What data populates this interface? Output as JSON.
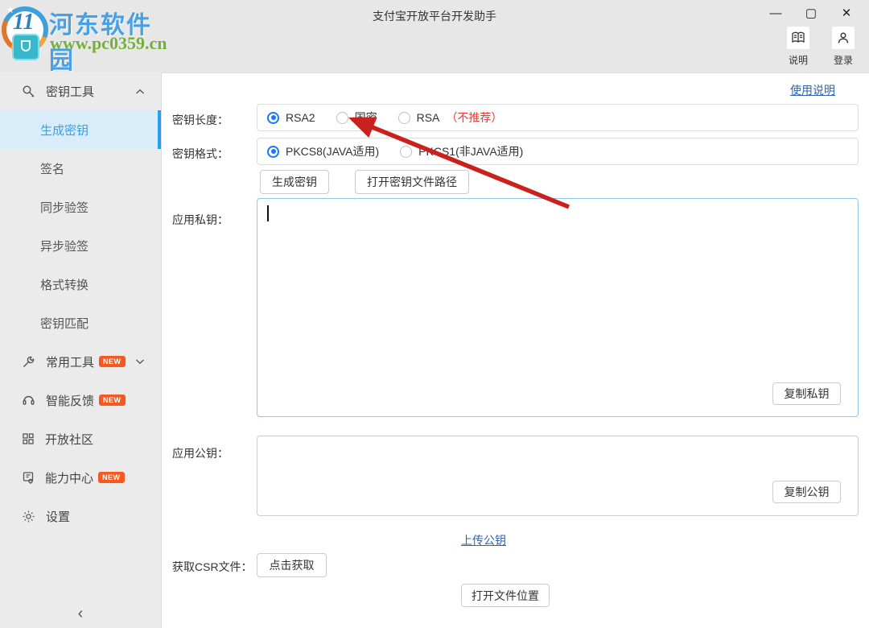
{
  "window": {
    "title": "支付宝开放平台开发助手",
    "minimize_glyph": "—",
    "maximize_glyph": "▢",
    "close_glyph": "✕"
  },
  "watermark": {
    "site_name": "河东软件园",
    "site_url": "www.pc0359.cn",
    "logo_number": "11",
    "logo_star": "★"
  },
  "topbar": {
    "help_label": "说明",
    "login_label": "登录"
  },
  "sidebar": {
    "key_tools_group": {
      "label": "密钥工具",
      "expanded": true
    },
    "sub_items": [
      {
        "label": "生成密钥",
        "active": true
      },
      {
        "label": "签名",
        "active": false
      },
      {
        "label": "同步验签",
        "active": false
      },
      {
        "label": "异步验签",
        "active": false
      },
      {
        "label": "格式转换",
        "active": false
      },
      {
        "label": "密钥匹配",
        "active": false
      }
    ],
    "items": [
      {
        "label": "常用工具",
        "badge": "NEW",
        "collapsed": true
      },
      {
        "label": "智能反馈",
        "badge": "NEW"
      },
      {
        "label": "开放社区",
        "badge": ""
      },
      {
        "label": "能力中心",
        "badge": "NEW"
      }
    ],
    "settings": {
      "label": "设置"
    },
    "collapse_glyph": "‹",
    "icons": [
      "key-icon",
      "wrench-icon",
      "headset-icon",
      "grid-icon",
      "capability-icon",
      "gear-icon",
      "chevron-up-icon",
      "chevron-down-icon"
    ]
  },
  "main": {
    "usage_link": "使用说明",
    "key_length": {
      "label": "密钥长度：",
      "options": [
        {
          "label": "RSA2",
          "selected": true
        },
        {
          "label": "国密",
          "selected": false
        },
        {
          "label": "RSA",
          "selected": false,
          "note": "（不推荐）"
        }
      ]
    },
    "key_format": {
      "label": "密钥格式：",
      "options": [
        {
          "label": "PKCS8(JAVA适用)",
          "selected": true
        },
        {
          "label": "PKCS1(非JAVA适用)",
          "selected": false
        }
      ]
    },
    "generate_button": "生成密钥",
    "open_key_path_button": "打开密钥文件路径",
    "private_key": {
      "label": "应用私钥：",
      "value": "",
      "copy_button": "复制私钥",
      "focused": true
    },
    "public_key": {
      "label": "应用公钥：",
      "value": "",
      "copy_button": "复制公钥"
    },
    "upload_link": "上传公钥",
    "csr": {
      "label": "获取CSR文件：",
      "button": "点击获取"
    },
    "open_file_location_button": "打开文件位置"
  },
  "annotation": {
    "arrow_color": "#c9221e",
    "arrow_points_to": "国密 radio option"
  },
  "colors": {
    "topbar_bg": "#e7e7e7",
    "sidebar_bg": "#ebebeb",
    "active_item_bg": "#d8ecf9",
    "active_item_text": "#3aa0e8",
    "active_item_bar": "#2a9fe8",
    "radio_blue": "#1677ff",
    "link_blue": "#2e64b1",
    "warn_red": "#f0342c",
    "badge_orange": "#f4591f",
    "focused_box_border": "#8fc7ee"
  }
}
